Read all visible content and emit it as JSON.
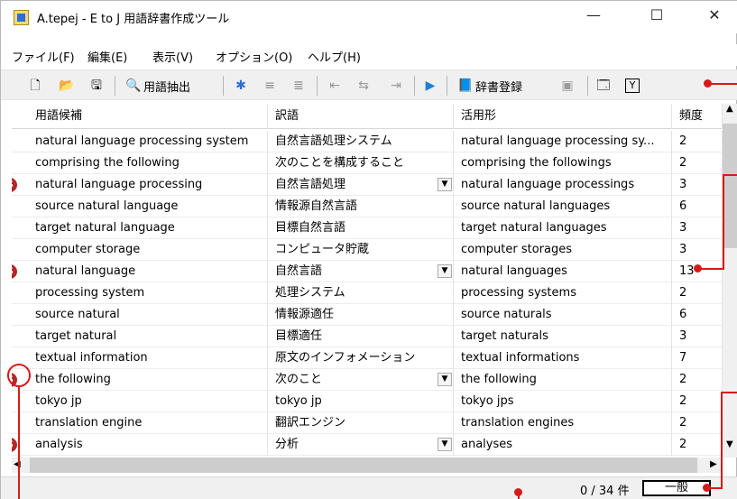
{
  "window": {
    "title": "A.tepej - E to J 用語辞書作成ツール",
    "controls": {
      "minimize": "—",
      "maximize": "☐",
      "close": "✕"
    }
  },
  "menu": [
    "ファイル(F)",
    "編集(E)",
    "表示(V)",
    "オプション(O)",
    "ヘルプ(H)"
  ],
  "toolbar": {
    "extract_label": "用語抽出",
    "register_label": "辞書登録"
  },
  "columns": [
    "用語候補",
    "訳語",
    "活用形",
    "頻度"
  ],
  "rows": [
    {
      "term": "natural language processing system",
      "trans": "自然言語処理システム",
      "inflect": "natural language processing sy...",
      "freq": "2",
      "badge": "",
      "drop": false
    },
    {
      "term": "comprising the following",
      "trans": "次のことを構成すること",
      "inflect": "comprising the followings",
      "freq": "2",
      "badge": "",
      "drop": false
    },
    {
      "term": "natural language processing",
      "trans": "自然言語処理",
      "inflect": "natural language processings",
      "freq": "3",
      "badge": "S",
      "drop": true
    },
    {
      "term": "source natural language",
      "trans": "情報源自然言語",
      "inflect": "source natural languages",
      "freq": "6",
      "badge": "",
      "drop": false
    },
    {
      "term": "target natural language",
      "trans": "目標自然言語",
      "inflect": "target natural languages",
      "freq": "3",
      "badge": "",
      "drop": false
    },
    {
      "term": "computer storage",
      "trans": "コンピュータ貯蔵",
      "inflect": "computer storages",
      "freq": "3",
      "badge": "",
      "drop": false
    },
    {
      "term": "natural language",
      "trans": "自然言語",
      "inflect": "natural languages",
      "freq": "13",
      "badge": "S",
      "drop": true
    },
    {
      "term": "processing system",
      "trans": "処理システム",
      "inflect": "processing systems",
      "freq": "2",
      "badge": "",
      "drop": false
    },
    {
      "term": "source natural",
      "trans": "情報源適任",
      "inflect": "source naturals",
      "freq": "6",
      "badge": "",
      "drop": false
    },
    {
      "term": "target natural",
      "trans": "目標適任",
      "inflect": "target naturals",
      "freq": "3",
      "badge": "",
      "drop": false
    },
    {
      "term": "textual information",
      "trans": "原文のインフォメーション",
      "inflect": "textual informations",
      "freq": "7",
      "badge": "",
      "drop": false
    },
    {
      "term": "the following",
      "trans": "次のこと",
      "inflect": "the following",
      "freq": "2",
      "badge": "S",
      "drop": true
    },
    {
      "term": "tokyo jp",
      "trans": "tokyo jp",
      "inflect": "tokyo jps",
      "freq": "2",
      "badge": "",
      "drop": false
    },
    {
      "term": "translation engine",
      "trans": "翻訳エンジン",
      "inflect": "translation engines",
      "freq": "2",
      "badge": "",
      "drop": false
    },
    {
      "term": "analysis",
      "trans": "分析",
      "inflect": "analyses",
      "freq": "2",
      "badge": "S",
      "drop": true
    }
  ],
  "status": {
    "count": "0 / 34 件",
    "genre": "一般"
  },
  "colors": {
    "badge": "#b52828",
    "callout": "#d71a1a"
  }
}
